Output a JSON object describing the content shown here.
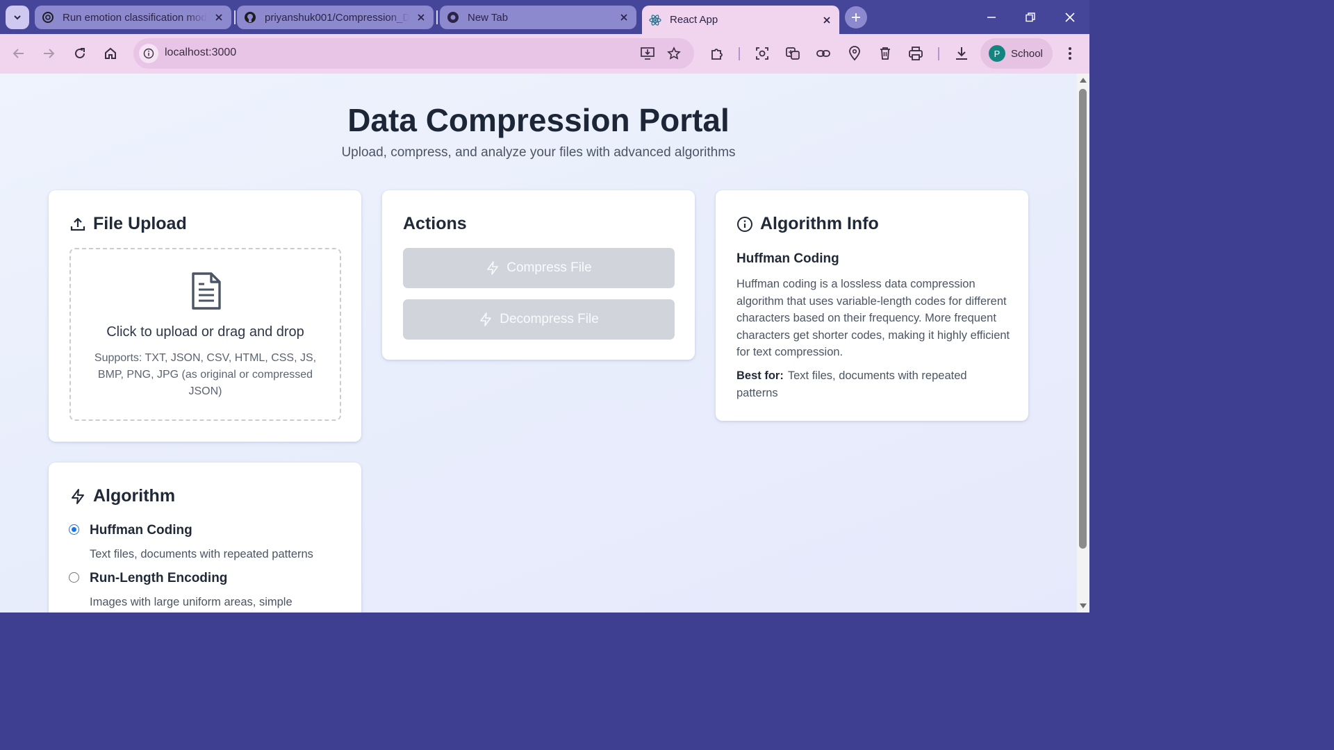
{
  "browser": {
    "tabs": [
      {
        "title": "Run emotion classification mod",
        "favicon": "chatgpt-icon",
        "active": false
      },
      {
        "title": "priyanshuk001/Compression_D",
        "favicon": "github-icon",
        "active": false
      },
      {
        "title": "New Tab",
        "favicon": "chrome-icon",
        "active": false
      },
      {
        "title": "React App",
        "favicon": "react-icon",
        "active": true
      }
    ],
    "url": "localhost:3000",
    "profile": {
      "initial": "P",
      "name": "School"
    },
    "colors": {
      "tabstrip": "#45469a",
      "toolbar": "#f1d4ed",
      "omnibox": "#e8c5e6"
    }
  },
  "page": {
    "title": "Data Compression Portal",
    "subtitle": "Upload, compress, and analyze your files with advanced algorithms"
  },
  "upload": {
    "heading": "File Upload",
    "dropzone_text": "Click to upload or drag and drop",
    "supports_text": "Supports: TXT, JSON, CSV, HTML, CSS, JS, BMP, PNG, JPG (as original or compressed JSON)"
  },
  "actions": {
    "heading": "Actions",
    "compress_label": "Compress File",
    "decompress_label": "Decompress File",
    "disabled_color": "#d1d5db"
  },
  "info": {
    "heading": "Algorithm Info",
    "name": "Huffman Coding",
    "description": "Huffman coding is a lossless data compression algorithm that uses variable-length codes for different characters based on their frequency. More frequent characters get shorter codes, making it highly efficient for text compression.",
    "best_for_label": "Best for:",
    "best_for_value": "Text files, documents with repeated patterns"
  },
  "algorithm": {
    "heading": "Algorithm",
    "options": [
      {
        "name": "Huffman Coding",
        "desc": "Text files, documents with repeated patterns",
        "selected": true
      },
      {
        "name": "Run-Length Encoding",
        "desc": "Images with large uniform areas, simple",
        "selected": false
      }
    ],
    "accent": "#1a73e8"
  }
}
